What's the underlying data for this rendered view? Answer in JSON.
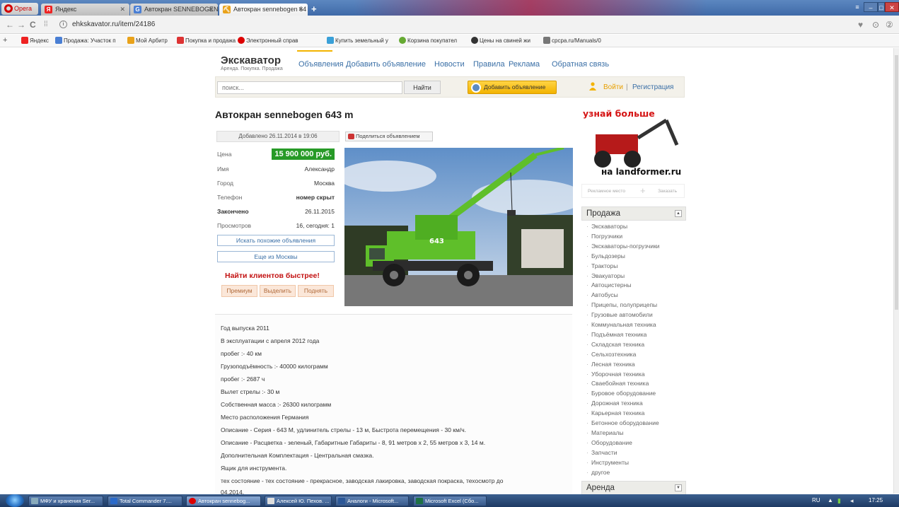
{
  "browser": {
    "opera_label": "Opera",
    "tabs": [
      {
        "label": "Яндекс",
        "icon": "yandex-icon",
        "active": false
      },
      {
        "label": "Автокран SENNEBOGEN",
        "icon": "google-icon",
        "active": false
      },
      {
        "label": "Автокран sennebogen 64",
        "icon": "site-icon",
        "active": true
      }
    ],
    "url": "ehkskavator.ru/item/24186",
    "bookmarks": [
      "Яндекс",
      "Продажа: Участок п",
      "Мой Арбитр",
      "Покупка и продажа",
      "Электронный справ",
      "Купить земельный у",
      "Корзина покупател",
      "Цены на свиней жи",
      "cpcpa.ru/Manuals/0"
    ]
  },
  "site": {
    "name": "Экскаватор",
    "tagline": "Аренда. Покупка. Продажа",
    "menu": [
      "Объявления",
      "Добавить объявление",
      "Новости",
      "Правила",
      "Реклама",
      "Обратная связь"
    ],
    "search_placeholder": "поиск...",
    "search_button": "Найти",
    "add_ad_button": "Добавить объявление",
    "login": "Войти",
    "separator": "|",
    "register": "Регистрация"
  },
  "listing": {
    "title": "Автокран sennebogen 643 m",
    "added": "Добавлено 26.11.2014 в 19:06",
    "share": "Поделиться объявлением",
    "fields": [
      {
        "key": "Цена",
        "value": "15 900 000 руб."
      },
      {
        "key": "Имя",
        "value": "Александр"
      },
      {
        "key": "Город",
        "value": "Москва"
      },
      {
        "key": "Телефон",
        "value": "номер скрыт"
      },
      {
        "key": "Закончено",
        "value": "26.11.2015"
      },
      {
        "key": "Просмотров",
        "value": "16, сегодня: 1"
      }
    ],
    "similar_button": "Искать похожие объявления",
    "more_moscow_button": "Еще из Москвы",
    "promo_title": "Найти клиентов быстрее!",
    "promo_buttons": [
      "Премиум",
      "Выделить",
      "Поднять"
    ],
    "photo_label": "643",
    "description": [
      "Год выпуска 2011",
      "В эксплуатации с апреля 2012 года",
      "пробег :- 40 км",
      "Грузоподъёмность :- 40000 килограмм",
      "пробег :- 2687 ч",
      "Вылет стрелы :- 30 м",
      "Собственная масса :- 26300 килограмм",
      "Место расположения Германия",
      "Описание - Серия - 643 М, удлинитель стрелы - 13 м, Быстрота перемещения - 30 км/ч.",
      "Описание - Расцветка - зеленый, Габаритные Габариты - 8, 91 метров х 2, 55 метров х 3, 14 м.",
      "Дополнительная Комплектация - Центральная смазка.",
      "Ящик для инструмента.",
      "тех состояние - тех состояние - прекрасное, заводская лакировка, заводская покраска, техосмотр до",
      "04.2014."
    ]
  },
  "sidebar": {
    "banner_top": "узнай больше",
    "banner_bottom": "на landformer.ru",
    "ad_slot_left": "Рекламное место",
    "ad_slot_plus": "+",
    "ad_slot_right": "Заказать",
    "sale_header": "Продажа",
    "categories": [
      "Экскаваторы",
      "Погрузчики",
      "Экскаваторы-погрузчики",
      "Бульдозеры",
      "Тракторы",
      "Эвакуаторы",
      "Автоцистерны",
      "Автобусы",
      "Прицепы, полуприцепы",
      "Грузовые автомобили",
      "Коммунальная техника",
      "Подъёмная техника",
      "Складская техника",
      "Сельхозтехника",
      "Лесная техника",
      "Уборочная техника",
      "Сваебойная техника",
      "Буровое оборудование",
      "Дорожная техника",
      "Карьерная техника",
      "Бетонное оборудование",
      "Материалы",
      "Оборудование",
      "Запчасти",
      "Инструменты",
      "другое"
    ],
    "rent_header": "Аренда"
  },
  "taskbar": {
    "items": [
      "МФУ и хранения Ser...",
      "Total Commander 7....",
      "Автокран sennebog...",
      "Алексей Ю. Пехов. ...",
      "Аналоги - Microsoft...",
      "Microsoft Excel (Сбо..."
    ],
    "lang": "RU",
    "time": "17:25"
  },
  "colors": {
    "price_bg": "#279a27",
    "accent_yellow": "#f3b300",
    "link_blue": "#3a6fa6",
    "crane_green": "#5fbf2a",
    "promo_red": "#c31212"
  }
}
